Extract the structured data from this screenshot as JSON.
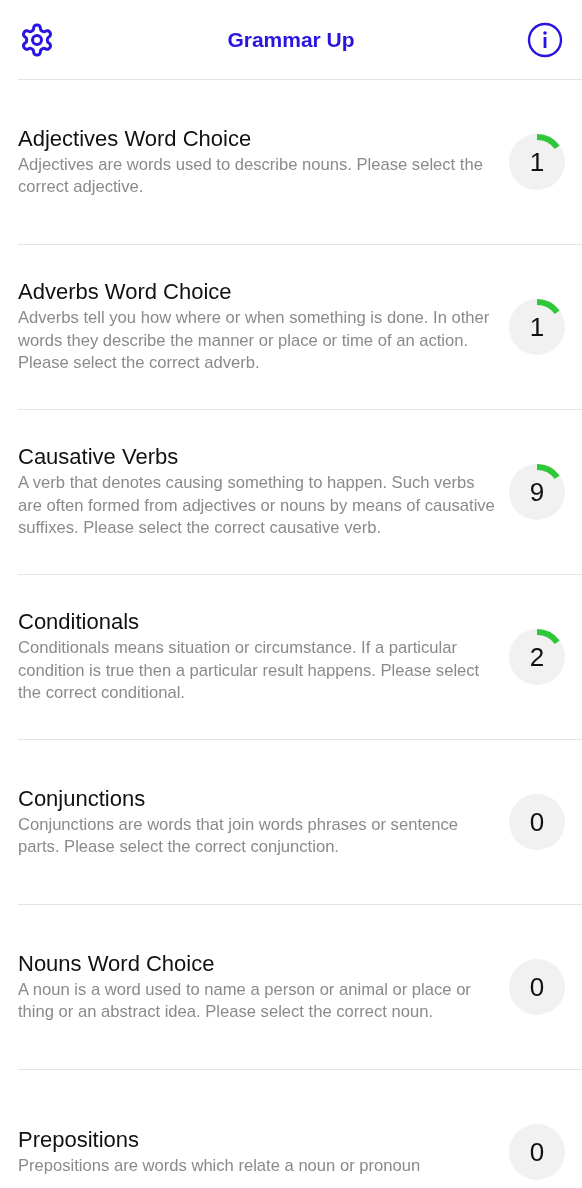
{
  "header": {
    "title": "Grammar Up"
  },
  "topics": [
    {
      "title": "Adjectives Word Choice",
      "description": "Adjectives are words used to describe nouns. Please select the correct adjective.",
      "count": "1",
      "kind": "started"
    },
    {
      "title": "Adverbs Word Choice",
      "description": "Adverbs tell you how where or when something is done. In other words they describe the manner or place or time of an action. Please select the correct adverb.",
      "count": "1",
      "kind": "started"
    },
    {
      "title": "Causative Verbs",
      "description": "A verb that denotes causing something to happen. Such verbs are often formed from adjectives or nouns by means of causative suffixes. Please select the correct causative verb.",
      "count": "9",
      "kind": "started"
    },
    {
      "title": "Conditionals",
      "description": "Conditionals means situation or circumstance. If a particular condition is true then a particular result happens. Please select the correct conditional.",
      "count": "2",
      "kind": "started"
    },
    {
      "title": "Conjunctions",
      "description": "Conjunctions are words that join words phrases or sentence parts. Please select the correct conjunction.",
      "count": "0",
      "kind": "empty"
    },
    {
      "title": "Nouns Word Choice",
      "description": "A noun is a word used to name a person or animal or place or thing or an abstract idea. Please select the correct noun.",
      "count": "0",
      "kind": "empty"
    },
    {
      "title": "Prepositions",
      "description": "Prepositions are words which relate a noun or pronoun",
      "count": "0",
      "kind": "empty"
    }
  ]
}
